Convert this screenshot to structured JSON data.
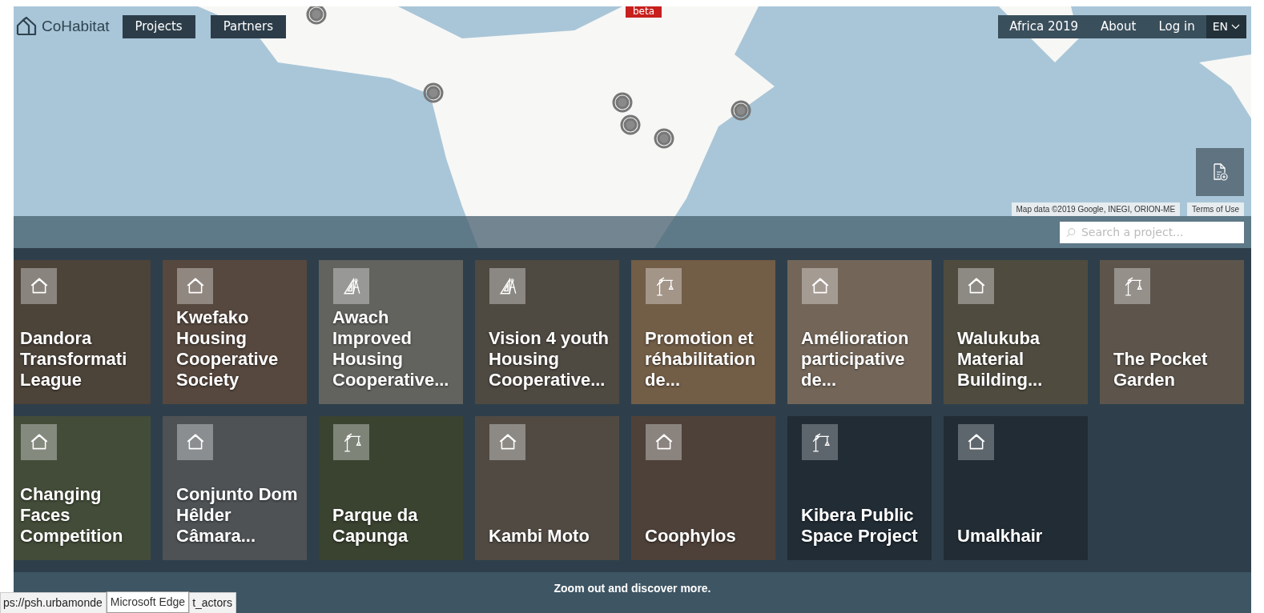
{
  "navbar": {
    "brand": "CoHabitat",
    "left_links": [
      {
        "label": "Projects"
      },
      {
        "label": "Partners"
      }
    ],
    "beta_badge": "beta",
    "right_links": [
      {
        "label": "Africa 2019"
      },
      {
        "label": "About"
      },
      {
        "label": "Log in"
      }
    ],
    "language": "EN"
  },
  "map": {
    "attribution": "Map data ©2019 Google, INEGI, ORION-ME",
    "terms": "Terms of Use"
  },
  "search": {
    "placeholder": "Search a project..."
  },
  "projects": [
    {
      "title": "Dandora Transformati League",
      "kind": "house",
      "photo": true
    },
    {
      "title": "Kwefako Housing Cooperative Society",
      "kind": "house",
      "photo": true
    },
    {
      "title": "Awach Improved Housing Cooperative...",
      "kind": "design",
      "photo": true
    },
    {
      "title": "Vision 4 youth Housing Cooperative...",
      "kind": "design",
      "photo": true
    },
    {
      "title": "Promotion et réhabilitation de...",
      "kind": "construction",
      "photo": true
    },
    {
      "title": "Amélioration participative de...",
      "kind": "house",
      "photo": true
    },
    {
      "title": "Walukuba Material Building...",
      "kind": "house",
      "photo": true
    },
    {
      "title": "The Pocket Garden",
      "kind": "construction",
      "photo": true
    },
    {
      "title": "Changing Faces Competition",
      "kind": "house",
      "photo": true
    },
    {
      "title": "Conjunto Dom Hêlder Câmara...",
      "kind": "house",
      "photo": true
    },
    {
      "title": "Parque da Capunga",
      "kind": "construction",
      "photo": true
    },
    {
      "title": "Kambi Moto",
      "kind": "house",
      "photo": true
    },
    {
      "title": "Coophylos",
      "kind": "house",
      "photo": true
    },
    {
      "title": "Kibera Public Space Project",
      "kind": "construction",
      "photo": false
    },
    {
      "title": "Umalkhair",
      "kind": "house",
      "photo": false
    }
  ],
  "footer": {
    "text": "Zoom out and discover more."
  },
  "status_bar": {
    "url_start": "ps://psh.urbamonde",
    "tooltip": "Microsoft Edge",
    "url_end": "t_actors"
  }
}
